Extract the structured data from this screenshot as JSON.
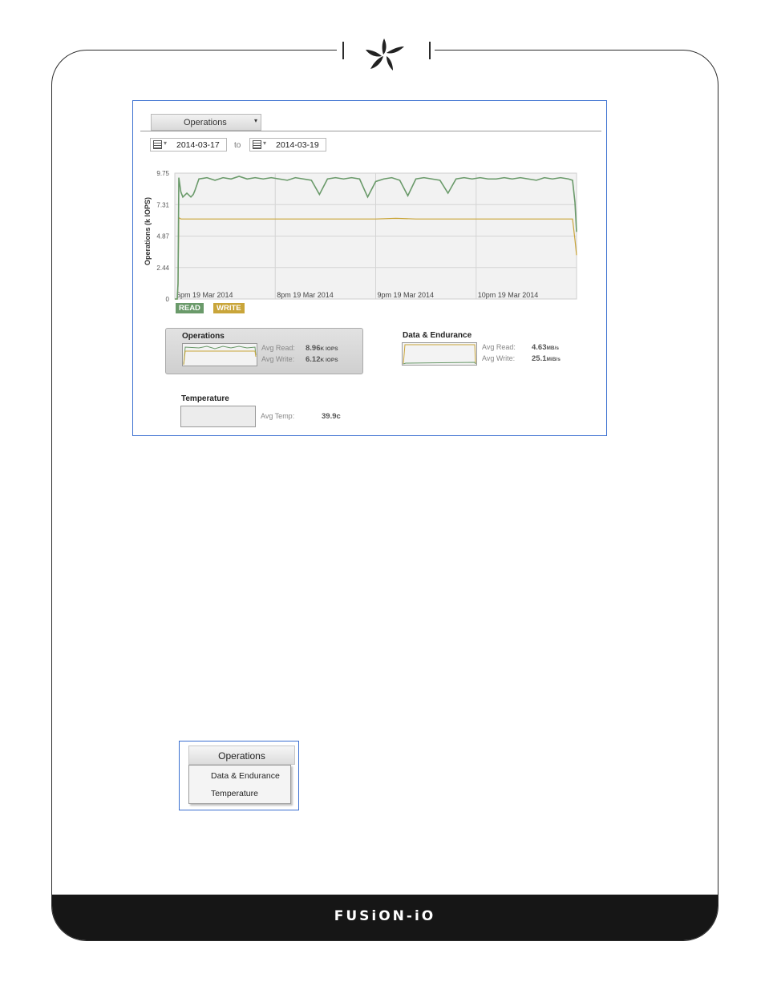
{
  "brand": {
    "footer_wordmark": "FUSiON-iO",
    "colors": {
      "frame": "#2b2b2b",
      "footer": "#161616",
      "highlight_border": "#3a6fd0"
    }
  },
  "screenshot": {
    "metric_select": {
      "label": "Operations",
      "icon": "chevron-down-icon"
    },
    "date_range": {
      "from": "2014-03-17",
      "to_label": "to",
      "to": "2014-03-19"
    },
    "legend": [
      {
        "label": "READ",
        "color": "#6a9a6a"
      },
      {
        "label": "WRITE",
        "color": "#c9a53a"
      }
    ],
    "summary": {
      "operations": {
        "title": "Operations",
        "avg_read_label": "Avg Read:",
        "avg_read_value": "8.96",
        "avg_read_unit": "K IOPS",
        "avg_write_label": "Avg Write:",
        "avg_write_value": "6.12",
        "avg_write_unit": "K IOPS"
      },
      "data_endurance": {
        "title": "Data & Endurance",
        "avg_read_label": "Avg Read:",
        "avg_read_value": "4.63",
        "avg_read_unit": "MB/s",
        "avg_write_label": "Avg Write:",
        "avg_write_value": "25.1",
        "avg_write_unit": "MiB/s"
      },
      "temperature": {
        "title": "Temperature",
        "avg_temp_label": "Avg Temp:",
        "avg_temp_value": "39.9c"
      }
    }
  },
  "chart_data": {
    "type": "line",
    "ylabel": "Operations (k IOPS)",
    "xlabel": "",
    "y_ticks": [
      "0",
      "2.44",
      "4.87",
      "7.31",
      "9.75"
    ],
    "ylim": [
      0,
      9.75
    ],
    "x_tick_labels": [
      "6pm 19 Mar 2014",
      "8pm 19 Mar 2014",
      "9pm 19 Mar 2014",
      "10pm 19 Mar 2014"
    ],
    "grid": true,
    "series": [
      {
        "name": "READ",
        "color": "#6a9a6a",
        "x": [
          0,
          0.3,
          0.6,
          0.8,
          1,
          1.5,
          2,
          3,
          4,
          4.6,
          5,
          6,
          8,
          10,
          12,
          14,
          16,
          18,
          20,
          22,
          24,
          26,
          28,
          30,
          32,
          34,
          36,
          38,
          40,
          42,
          44,
          46,
          48,
          50,
          52,
          54,
          56,
          58,
          60,
          62,
          64,
          66,
          68,
          70,
          72,
          74,
          76,
          78,
          80,
          82,
          84,
          86,
          88,
          90,
          92,
          94,
          96,
          98,
          99,
          99.6,
          100
        ],
        "y": [
          0,
          0,
          0,
          1.2,
          9.4,
          8.3,
          7.9,
          8.2,
          7.9,
          8.1,
          8.4,
          9.3,
          9.4,
          9.2,
          9.4,
          9.3,
          9.5,
          9.3,
          9.4,
          9.3,
          9.4,
          9.3,
          9.2,
          9.4,
          9.3,
          9.2,
          8.1,
          9.3,
          9.4,
          9.3,
          9.4,
          9.3,
          7.9,
          9.1,
          9.3,
          9.4,
          9.2,
          8.0,
          9.3,
          9.4,
          9.3,
          9.2,
          8.2,
          9.3,
          9.4,
          9.3,
          9.4,
          9.3,
          9.3,
          9.4,
          9.3,
          9.4,
          9.3,
          9.2,
          9.4,
          9.3,
          9.4,
          9.3,
          9.2,
          7.5,
          5.2
        ]
      },
      {
        "name": "WRITE",
        "color": "#c9a53a",
        "x": [
          0,
          0.3,
          0.6,
          0.8,
          1,
          1.5,
          5,
          10,
          20,
          30,
          40,
          50,
          55,
          60,
          70,
          80,
          90,
          98,
          99,
          99.6,
          100
        ],
        "y": [
          0,
          0,
          0,
          1.0,
          6.3,
          6.2,
          6.2,
          6.2,
          6.2,
          6.2,
          6.2,
          6.2,
          6.25,
          6.2,
          6.2,
          6.2,
          6.2,
          6.2,
          6.2,
          4.6,
          3.4
        ]
      }
    ]
  },
  "dropdown_example": {
    "selected": "Operations",
    "options": [
      "Data & Endurance",
      "Temperature"
    ]
  }
}
